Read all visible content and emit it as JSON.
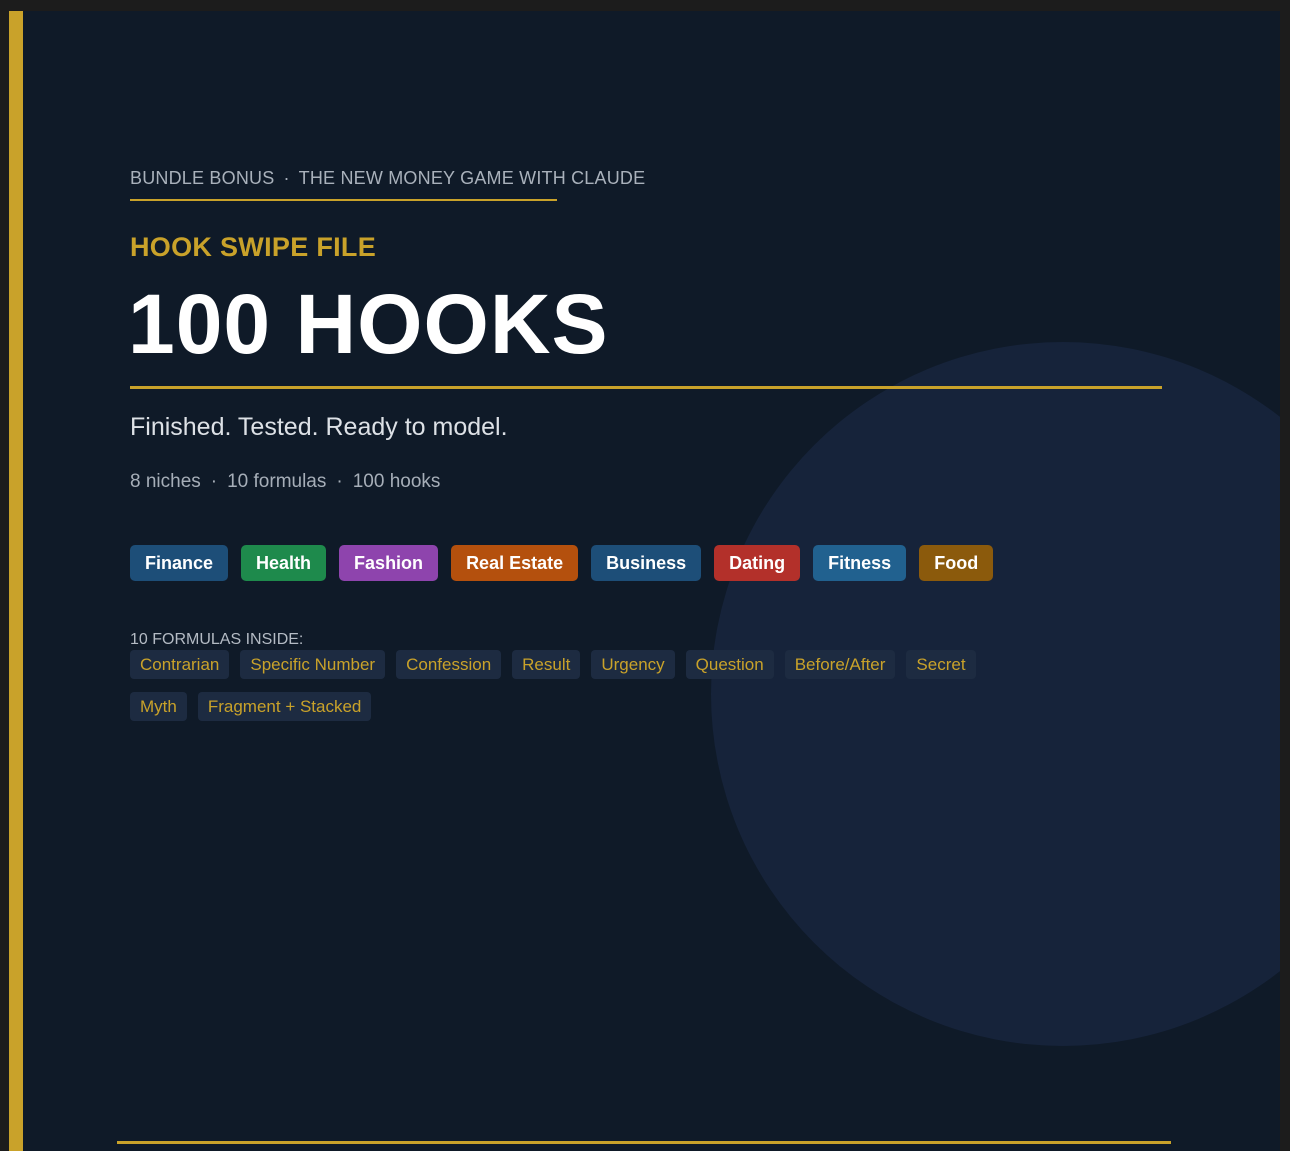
{
  "kicker": {
    "left": "BUNDLE BONUS",
    "separator": "·",
    "right": "THE NEW MONEY GAME WITH CLAUDE"
  },
  "eyebrow": "HOOK SWIPE FILE",
  "title": "100 HOOKS",
  "subtitle": "Finished. Tested. Ready to model.",
  "stats": {
    "items": [
      "8 niches",
      "10 formulas",
      "100 hooks"
    ],
    "separator": "·"
  },
  "niches": [
    {
      "label": "Finance",
      "color": "#1d4e78"
    },
    {
      "label": "Health",
      "color": "#1e8a4c"
    },
    {
      "label": "Fashion",
      "color": "#8e44ad"
    },
    {
      "label": "Real Estate",
      "color": "#b4500d"
    },
    {
      "label": "Business",
      "color": "#1d4e78"
    },
    {
      "label": "Dating",
      "color": "#b3302a"
    },
    {
      "label": "Fitness",
      "color": "#21618f"
    },
    {
      "label": "Food",
      "color": "#8b5a0c"
    }
  ],
  "formulas_label": "10 FORMULAS INSIDE:",
  "formulas": [
    "Contrarian",
    "Specific Number",
    "Confession",
    "Result",
    "Urgency",
    "Question",
    "Before/After",
    "Secret",
    "Myth",
    "Fragment + Stacked"
  ],
  "colors": {
    "accent": "#c9a22a",
    "background": "#0f1a28",
    "circle": "#16233a",
    "formula_tag_bg": "#1d2b41"
  }
}
